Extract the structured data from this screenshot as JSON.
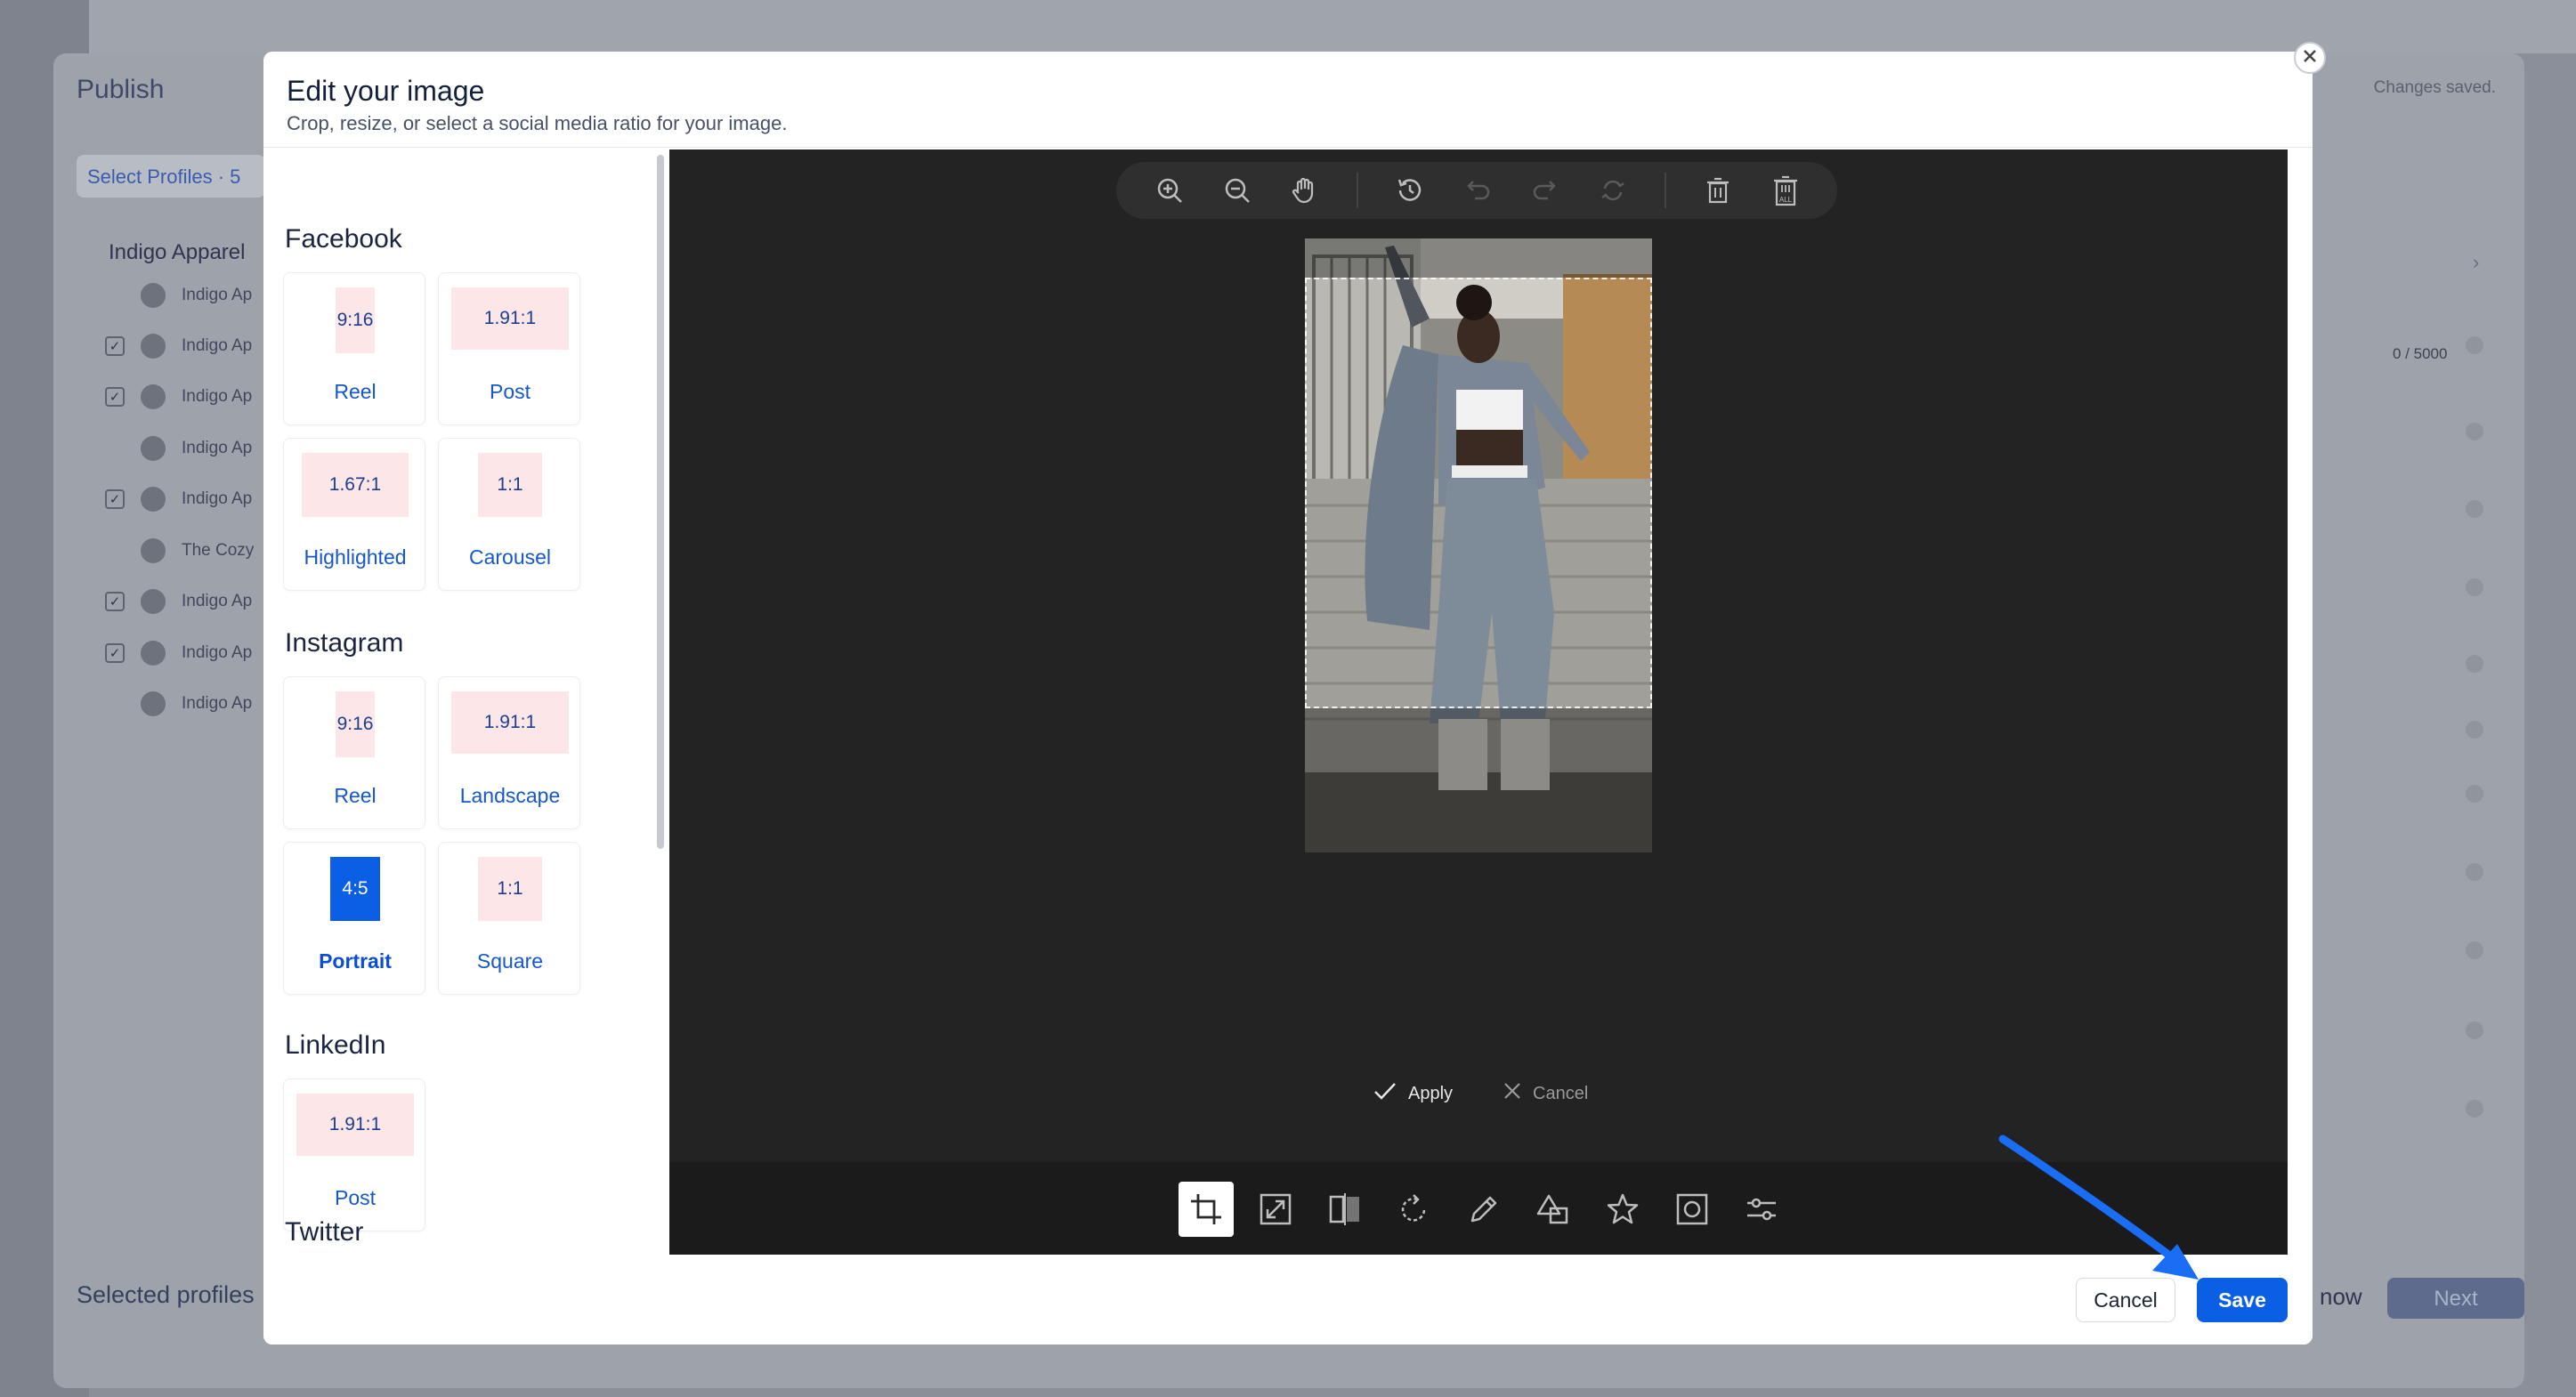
{
  "background": {
    "title": "Publish",
    "select_profiles": "Select Profiles · 5",
    "group_name": "Indigo Apparel",
    "items": [
      {
        "label": "Indigo Ap",
        "checked": false
      },
      {
        "label": "Indigo Ap",
        "checked": true
      },
      {
        "label": "Indigo Ap",
        "checked": true
      },
      {
        "label": "Indigo Ap",
        "checked": false
      },
      {
        "label": "Indigo Ap",
        "checked": true
      },
      {
        "label": "The Cozy",
        "checked": false
      },
      {
        "label": "Indigo Ap",
        "checked": true
      },
      {
        "label": "Indigo Ap",
        "checked": true
      },
      {
        "label": "Indigo Ap",
        "checked": false
      }
    ],
    "selected_profiles": "Selected profiles",
    "changes_saved": "Changes saved.",
    "counter": "0 / 5000",
    "now_label": "now",
    "next_label": "Next"
  },
  "modal": {
    "title": "Edit your image",
    "subtitle": "Crop, resize, or select a social media ratio for your image.",
    "sections": [
      {
        "name": "Facebook",
        "ratios": [
          {
            "ratio": "9:16",
            "label": "Reel"
          },
          {
            "ratio": "1.91:1",
            "label": "Post"
          },
          {
            "ratio": "1.67:1",
            "label": "Highlighted"
          },
          {
            "ratio": "1:1",
            "label": "Carousel"
          }
        ]
      },
      {
        "name": "Instagram",
        "ratios": [
          {
            "ratio": "9:16",
            "label": "Reel"
          },
          {
            "ratio": "1.91:1",
            "label": "Landscape"
          },
          {
            "ratio": "4:5",
            "label": "Portrait",
            "selected": true
          },
          {
            "ratio": "1:1",
            "label": "Square"
          }
        ]
      },
      {
        "name": "LinkedIn",
        "ratios": [
          {
            "ratio": "1.91:1",
            "label": "Post"
          }
        ]
      },
      {
        "name": "Twitter",
        "ratios": []
      }
    ],
    "editor": {
      "top_tools": [
        "zoom-in-icon",
        "zoom-out-icon",
        "pan-hand-icon",
        "history-icon",
        "undo-icon",
        "redo-icon",
        "reset-icon",
        "delete-icon",
        "delete-all-icon"
      ],
      "apply_label": "Apply",
      "cancel_label": "Cancel",
      "bottom_tools": [
        "crop-icon",
        "resize-icon",
        "flip-icon",
        "rotate-icon",
        "draw-icon",
        "shape-icon",
        "sticker-icon",
        "frame-icon",
        "adjust-icon"
      ],
      "active_tool": "crop-icon"
    },
    "footer": {
      "cancel_label": "Cancel",
      "save_label": "Save"
    },
    "accent": "#0b5fe4"
  }
}
